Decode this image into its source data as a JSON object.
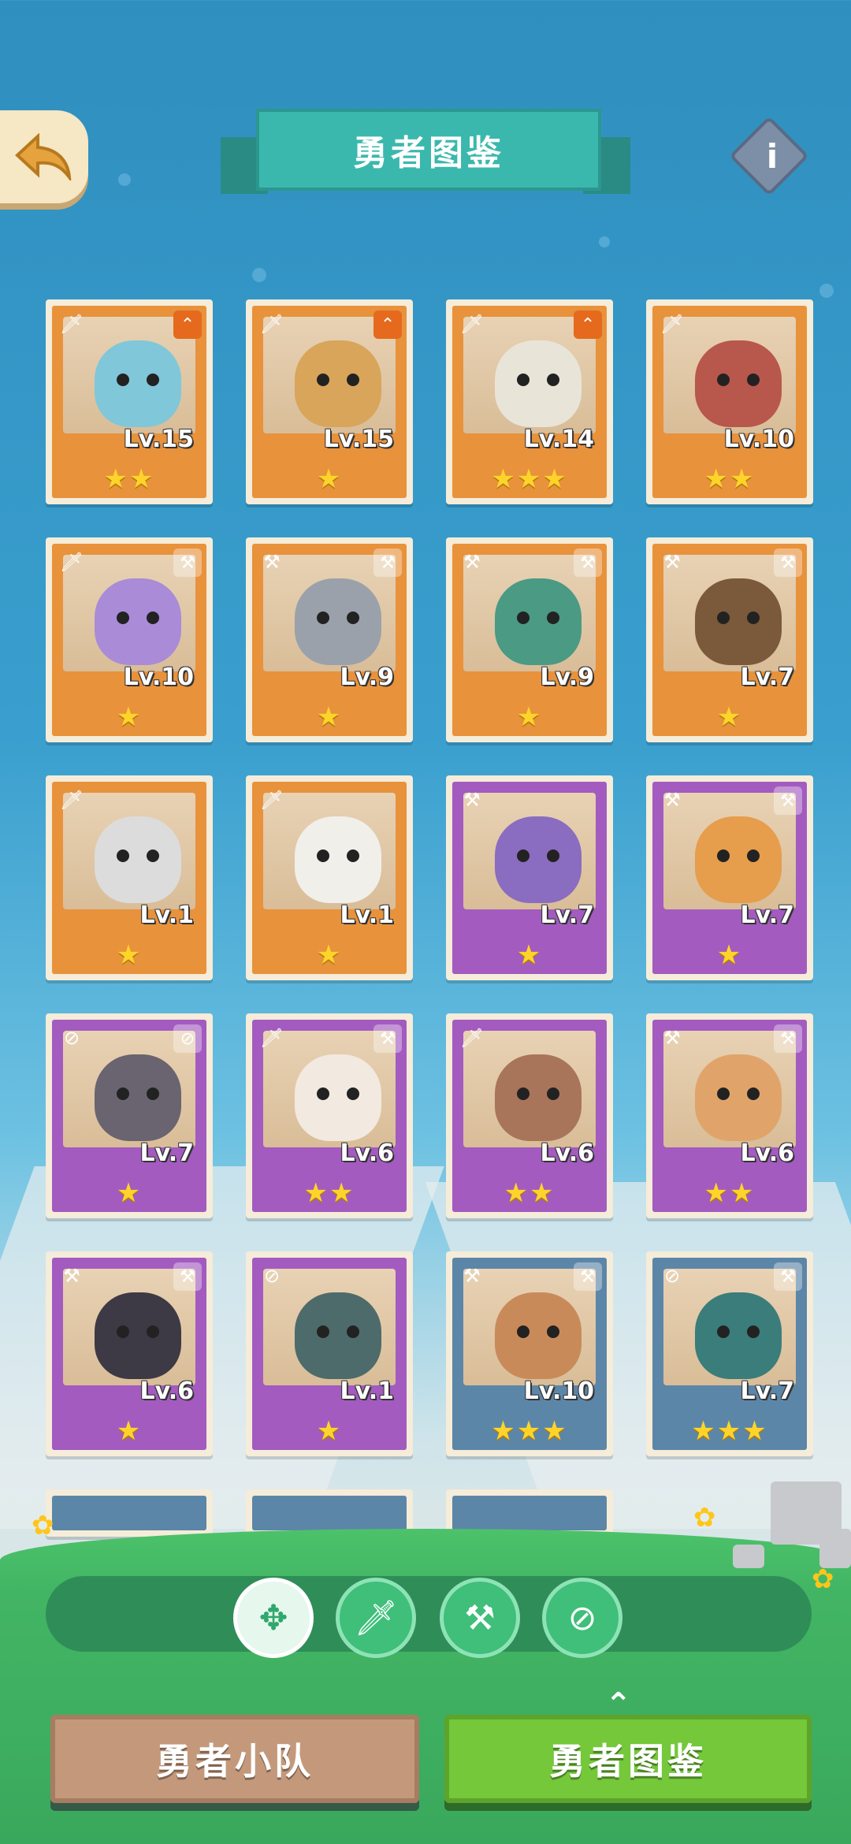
{
  "header": {
    "title": "勇者图鉴",
    "back_icon": "back-arrow-icon",
    "info_label": "i"
  },
  "colors": {
    "orange": "#e8923c",
    "purple": "#a35bc0",
    "blue": "#5c86a8",
    "teal": "#3bb8ad",
    "star": "#ffd42a"
  },
  "heroes": [
    {
      "level": "Lv.15",
      "stars": "★★",
      "frame": "orange",
      "class_icon": "sword-icon",
      "corner_icon": "rank-up-icon",
      "portrait": "polar-bear"
    },
    {
      "level": "Lv.15",
      "stars": "★",
      "frame": "orange",
      "class_icon": "sword-icon",
      "corner_icon": "rank-up-icon",
      "portrait": "lynx"
    },
    {
      "level": "Lv.14",
      "stars": "★★★",
      "frame": "orange",
      "class_icon": "sword-icon",
      "corner_icon": "rank-up-icon",
      "portrait": "panda"
    },
    {
      "level": "Lv.10",
      "stars": "★★",
      "frame": "orange",
      "class_icon": "sword-icon",
      "corner_icon": "",
      "portrait": "monkey"
    },
    {
      "level": "Lv.10",
      "stars": "★",
      "frame": "orange",
      "class_icon": "sword-icon",
      "corner_icon": "hammer-icon",
      "portrait": "elephant"
    },
    {
      "level": "Lv.9",
      "stars": "★",
      "frame": "orange",
      "class_icon": "hammer-icon",
      "corner_icon": "hammer-icon",
      "portrait": "gorilla"
    },
    {
      "level": "Lv.9",
      "stars": "★",
      "frame": "orange",
      "class_icon": "hammer-icon",
      "corner_icon": "hammer-icon",
      "portrait": "crocodile"
    },
    {
      "level": "Lv.7",
      "stars": "★",
      "frame": "orange",
      "class_icon": "hammer-icon",
      "corner_icon": "hammer-icon",
      "portrait": "lion"
    },
    {
      "level": "Lv.1",
      "stars": "★",
      "frame": "orange",
      "class_icon": "sword-icon",
      "corner_icon": "",
      "portrait": "white-wolf"
    },
    {
      "level": "Lv.1",
      "stars": "★",
      "frame": "orange",
      "class_icon": "sword-icon",
      "corner_icon": "",
      "portrait": "seal"
    },
    {
      "level": "Lv.7",
      "stars": "★",
      "frame": "purple",
      "class_icon": "hammer-icon",
      "corner_icon": "",
      "portrait": "rhino"
    },
    {
      "level": "Lv.7",
      "stars": "★",
      "frame": "purple",
      "class_icon": "hammer-icon",
      "corner_icon": "hammer-icon",
      "portrait": "eagle"
    },
    {
      "level": "Lv.7",
      "stars": "★",
      "frame": "purple",
      "class_icon": "compass-icon",
      "corner_icon": "compass-icon",
      "portrait": "goat-ninja"
    },
    {
      "level": "Lv.6",
      "stars": "★★",
      "frame": "purple",
      "class_icon": "sword-icon",
      "corner_icon": "hammer-icon",
      "portrait": "sheep"
    },
    {
      "level": "Lv.6",
      "stars": "★★",
      "frame": "purple",
      "class_icon": "sword-icon",
      "corner_icon": "",
      "portrait": "lizard"
    },
    {
      "level": "Lv.6",
      "stars": "★★",
      "frame": "purple",
      "class_icon": "hammer-icon",
      "corner_icon": "hammer-icon",
      "portrait": "pangolin"
    },
    {
      "level": "Lv.6",
      "stars": "★",
      "frame": "purple",
      "class_icon": "hammer-icon",
      "corner_icon": "hammer-icon",
      "portrait": "black-cat"
    },
    {
      "level": "Lv.1",
      "stars": "★",
      "frame": "purple",
      "class_icon": "compass-icon",
      "corner_icon": "",
      "portrait": "penguins"
    },
    {
      "level": "Lv.10",
      "stars": "★★★",
      "frame": "blue",
      "class_icon": "hammer-icon",
      "corner_icon": "hammer-icon",
      "portrait": "deer-girl"
    },
    {
      "level": "Lv.7",
      "stars": "★★★",
      "frame": "blue",
      "class_icon": "compass-icon",
      "corner_icon": "hammer-icon",
      "portrait": "frog"
    }
  ],
  "filters": [
    {
      "name": "all",
      "icon": "all-classes-icon",
      "glyph": "✥"
    },
    {
      "name": "sword",
      "icon": "sword-icon",
      "glyph": "🗡"
    },
    {
      "name": "hammer",
      "icon": "hammer-icon",
      "glyph": "⚒"
    },
    {
      "name": "compass",
      "icon": "compass-icon",
      "glyph": "⊘"
    }
  ],
  "nav": {
    "team_label": "勇者小队",
    "codex_label": "勇者图鉴"
  }
}
